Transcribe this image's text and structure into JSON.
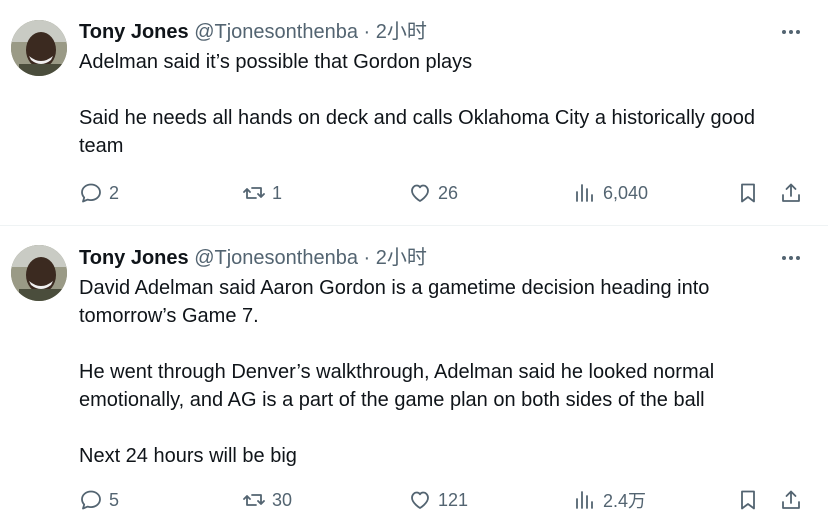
{
  "tweets": [
    {
      "author_name": "Tony Jones",
      "handle": "@Tjonesonthenba",
      "separator": "·",
      "time": "2小时",
      "paragraphs": [
        "Adelman said it’s possible that Gordon plays",
        "Said he needs all hands on deck and calls Oklahoma City a historically good team"
      ],
      "replies": "2",
      "retweets": "1",
      "likes": "26",
      "views": "6,040"
    },
    {
      "author_name": "Tony Jones",
      "handle": "@Tjonesonthenba",
      "separator": "·",
      "time": "2小时",
      "paragraphs": [
        "David Adelman said Aaron Gordon is a gametime decision heading into tomorrow’s Game 7.",
        "He went through Denver’s walkthrough, Adelman said he looked normal emotionally, and AG is a part of the game plan on both sides of the ball",
        "Next 24 hours will be big"
      ],
      "replies": "5",
      "retweets": "30",
      "likes": "121",
      "views": "2.4万"
    }
  ],
  "icons": {
    "more": "more-dots-icon",
    "reply": "reply-bubble-icon",
    "retweet": "retweet-arrows-icon",
    "like": "heart-icon",
    "views": "views-bar-chart-icon",
    "bookmark": "bookmark-icon",
    "share": "share-upload-icon"
  },
  "colors": {
    "text": "#0f1419",
    "secondary": "#536471",
    "divider": "#eff3f4"
  }
}
